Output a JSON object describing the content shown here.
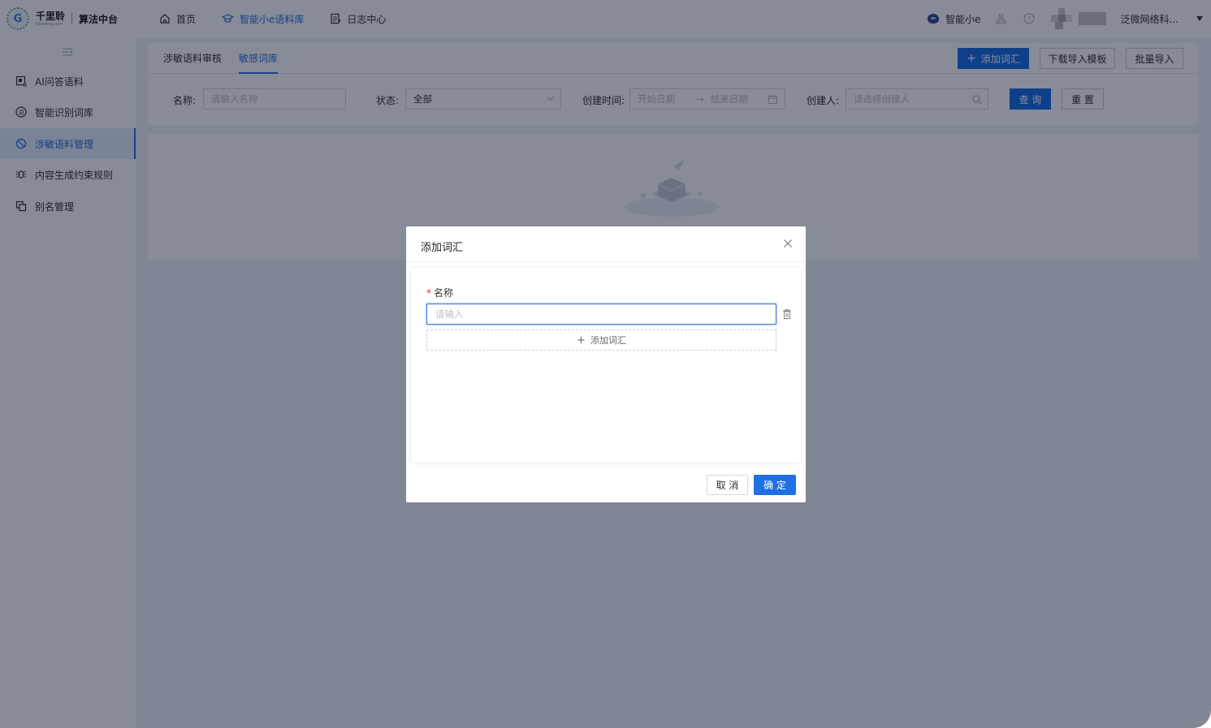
{
  "brand": {
    "logo_letter": "G",
    "name": "千里聆",
    "sub": "Qianling.com",
    "platform": "算法中台"
  },
  "topnav": {
    "items": [
      {
        "label": "首页",
        "icon": "home-icon"
      },
      {
        "label": "智能小e语料库",
        "icon": "graduation-cap-icon",
        "active": true
      },
      {
        "label": "日志中心",
        "icon": "log-icon"
      }
    ]
  },
  "user": {
    "assistant": "智能小e",
    "company": "泛微网络科..."
  },
  "sidebar": {
    "items": [
      {
        "label": "AI问答语料",
        "icon": "qa-corpus-icon"
      },
      {
        "label": "智能识别词库",
        "icon": "dictionary-icon"
      },
      {
        "label": "涉敏语料管理",
        "icon": "forbidden-icon",
        "active": true
      },
      {
        "label": "内容生成约束规则",
        "icon": "rule-icon"
      },
      {
        "label": "别名管理",
        "icon": "alias-icon"
      }
    ]
  },
  "tabs": [
    {
      "label": "涉敏语料审核"
    },
    {
      "label": "敏感词库",
      "active": true
    }
  ],
  "actions": {
    "add": "添加词汇",
    "download_template": "下载导入模板",
    "batch_import": "批量导入"
  },
  "filters": {
    "name_label": "名称:",
    "name_placeholder": "请输入名称",
    "status_label": "状态:",
    "status_value": "全部",
    "created_label": "创建时间:",
    "start_placeholder": "开始日期",
    "end_placeholder": "结束日期",
    "creator_label": "创建人:",
    "creator_placeholder": "请选择创建人",
    "query": "查 询",
    "reset": "重 置"
  },
  "modal": {
    "title": "添加词汇",
    "field_label": "名称",
    "input_placeholder": "请输入",
    "add_term": "添加词汇",
    "cancel": "取 消",
    "confirm": "确 定"
  },
  "colors": {
    "primary": "#1f6fe5",
    "required": "#f5222d",
    "mask": "rgba(0,10,35,0.47)"
  }
}
